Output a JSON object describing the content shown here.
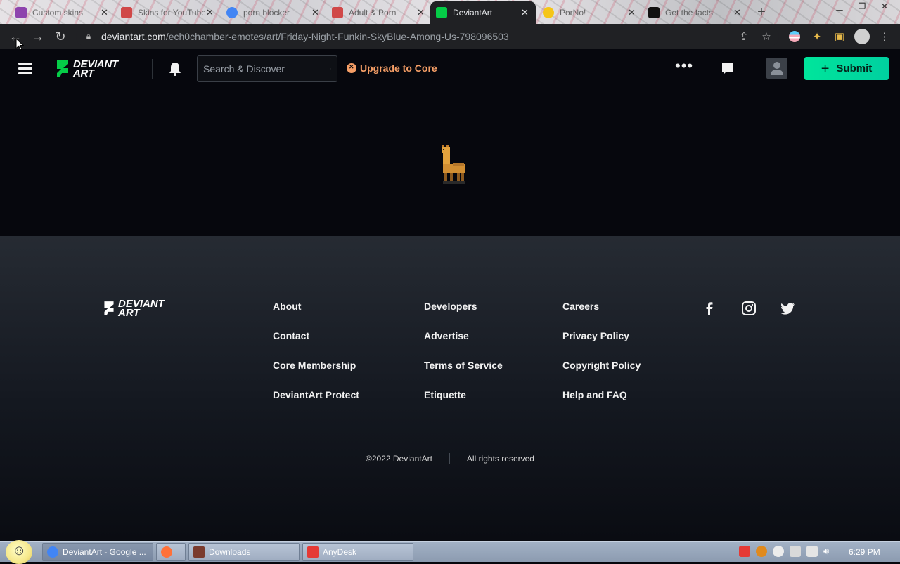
{
  "browser": {
    "tabs": [
      {
        "label": "Custom skins",
        "favicon_color": "#8e44ad"
      },
      {
        "label": "Skins for YouTube",
        "favicon_color": "#d04848"
      },
      {
        "label": "porn blocker",
        "favicon_color": "#4285f4"
      },
      {
        "label": "Adult & Porn",
        "favicon_color": "#d04848"
      },
      {
        "label": "DeviantArt",
        "favicon_color": "#05cc47",
        "active": true
      },
      {
        "label": "PorNo!",
        "favicon_color": "#f5c518"
      },
      {
        "label": "Get the facts",
        "favicon_color": "#111111"
      }
    ],
    "url_host": "deviantart.com",
    "url_path": "/ech0chamber-emotes/art/Friday-Night-Funkin-SkyBlue-Among-Us-798096503"
  },
  "header": {
    "logo_line1": "DEVIANT",
    "logo_line2": "ART",
    "search_placeholder": "Search & Discover",
    "upgrade_label": "Upgrade to Core",
    "submit_label": "Submit",
    "submit_plus": "+"
  },
  "footer": {
    "logo_line1": "DEVIANT",
    "logo_line2": "ART",
    "col1": [
      "About",
      "Contact",
      "Core Membership",
      "DeviantArt Protect"
    ],
    "col2": [
      "Developers",
      "Advertise",
      "Terms of Service",
      "Etiquette"
    ],
    "col3": [
      "Careers",
      "Privacy Policy",
      "Copyright Policy",
      "Help and FAQ"
    ],
    "copyright": "©2022 DeviantArt",
    "rights": "All rights reserved"
  },
  "taskbar": {
    "buttons": [
      {
        "label": "DeviantArt - Google ...",
        "icon_color": "#4285f4"
      },
      {
        "label": "",
        "icon_color": "#ff7139"
      },
      {
        "label": "Downloads",
        "icon_color": "#7a3b2e"
      },
      {
        "label": "AnyDesk",
        "icon_color": "#e53935"
      }
    ],
    "clock": "6:29 PM"
  },
  "colors": {
    "accent": "#00e59b",
    "upgrade": "#f59e66",
    "page_bg": "#06070d"
  }
}
